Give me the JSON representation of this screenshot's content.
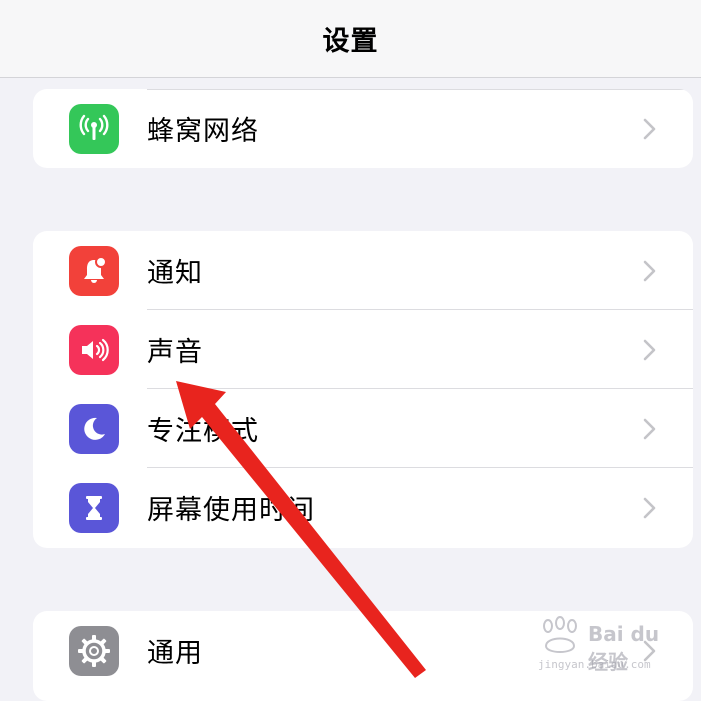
{
  "header": {
    "title": "设置"
  },
  "groups": [
    {
      "items": [
        {
          "label": "蜂窝网络",
          "icon": "cellular-antenna-icon",
          "color": "#34c759"
        }
      ]
    },
    {
      "items": [
        {
          "label": "通知",
          "icon": "bell-badge-icon",
          "color": "#ff3b30"
        },
        {
          "label": "声音",
          "icon": "speaker-wave-icon",
          "color": "#ff2d55"
        },
        {
          "label": "专注模式",
          "icon": "moon-icon",
          "color": "#5856d6"
        },
        {
          "label": "屏幕使用时间",
          "icon": "hourglass-icon",
          "color": "#5856d6"
        }
      ]
    },
    {
      "items": [
        {
          "label": "通用",
          "icon": "gear-icon",
          "color": "#8e8e93"
        }
      ]
    }
  ],
  "annotation": {
    "color": "#e8241e"
  },
  "watermark": {
    "brand": "Bai du 经验",
    "url": "jingyan.baidu.com"
  }
}
